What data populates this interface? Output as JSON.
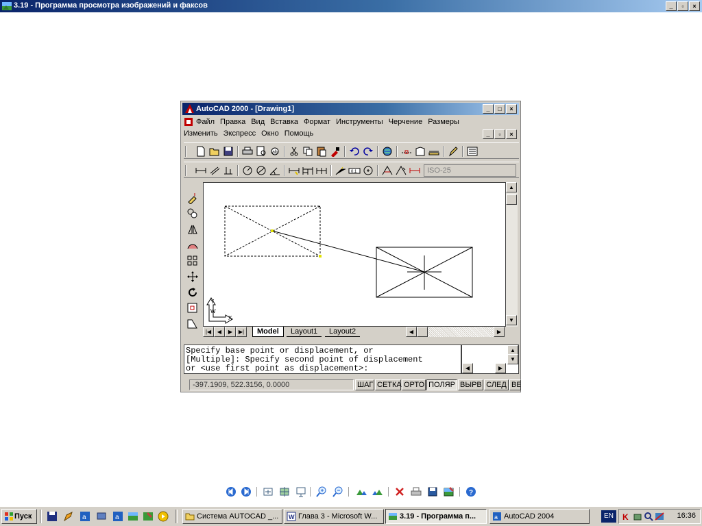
{
  "viewer": {
    "title": "3.19 - Программа просмотра изображений и факсов"
  },
  "acad": {
    "title": "AutoCAD 2000 - [Drawing1]",
    "menu_row1": [
      "Файл",
      "Правка",
      "Вид",
      "Вставка",
      "Формат",
      "Инструменты",
      "Черчение",
      "Размеры"
    ],
    "menu_row2": [
      "Изменить",
      "Экспресс",
      "Окно",
      "Помощь"
    ],
    "dimstyle": "ISO-25",
    "tabs": [
      "Model",
      "Layout1",
      "Layout2"
    ],
    "command_lines": [
      "Specify base point or displacement, or",
      "[Multiple]: Specify second point of displacement",
      "or <use first point as displacement>:"
    ],
    "coords": "-397.1909, 522.3156, 0.0000",
    "status_toggles": [
      "ШАГ",
      "СЕТКА",
      "ОРТО",
      "ПОЛЯР",
      "ВЫРВ",
      "СЛЕД",
      "ВЕ"
    ],
    "ucs_x": "X",
    "ucs_y": "Y",
    "ucs_w": "W"
  },
  "taskbar": {
    "start_label": "Пуск",
    "tasks": [
      "Система AUTOCAD _...",
      "Глава 3 - Microsoft W...",
      "3.19 - Программа п...",
      "AutoCAD 2004"
    ],
    "lang": "EN",
    "clock": "16:36"
  },
  "colors": {
    "title_gradient_start": "#0a246a",
    "face": "#d4d0c8"
  }
}
